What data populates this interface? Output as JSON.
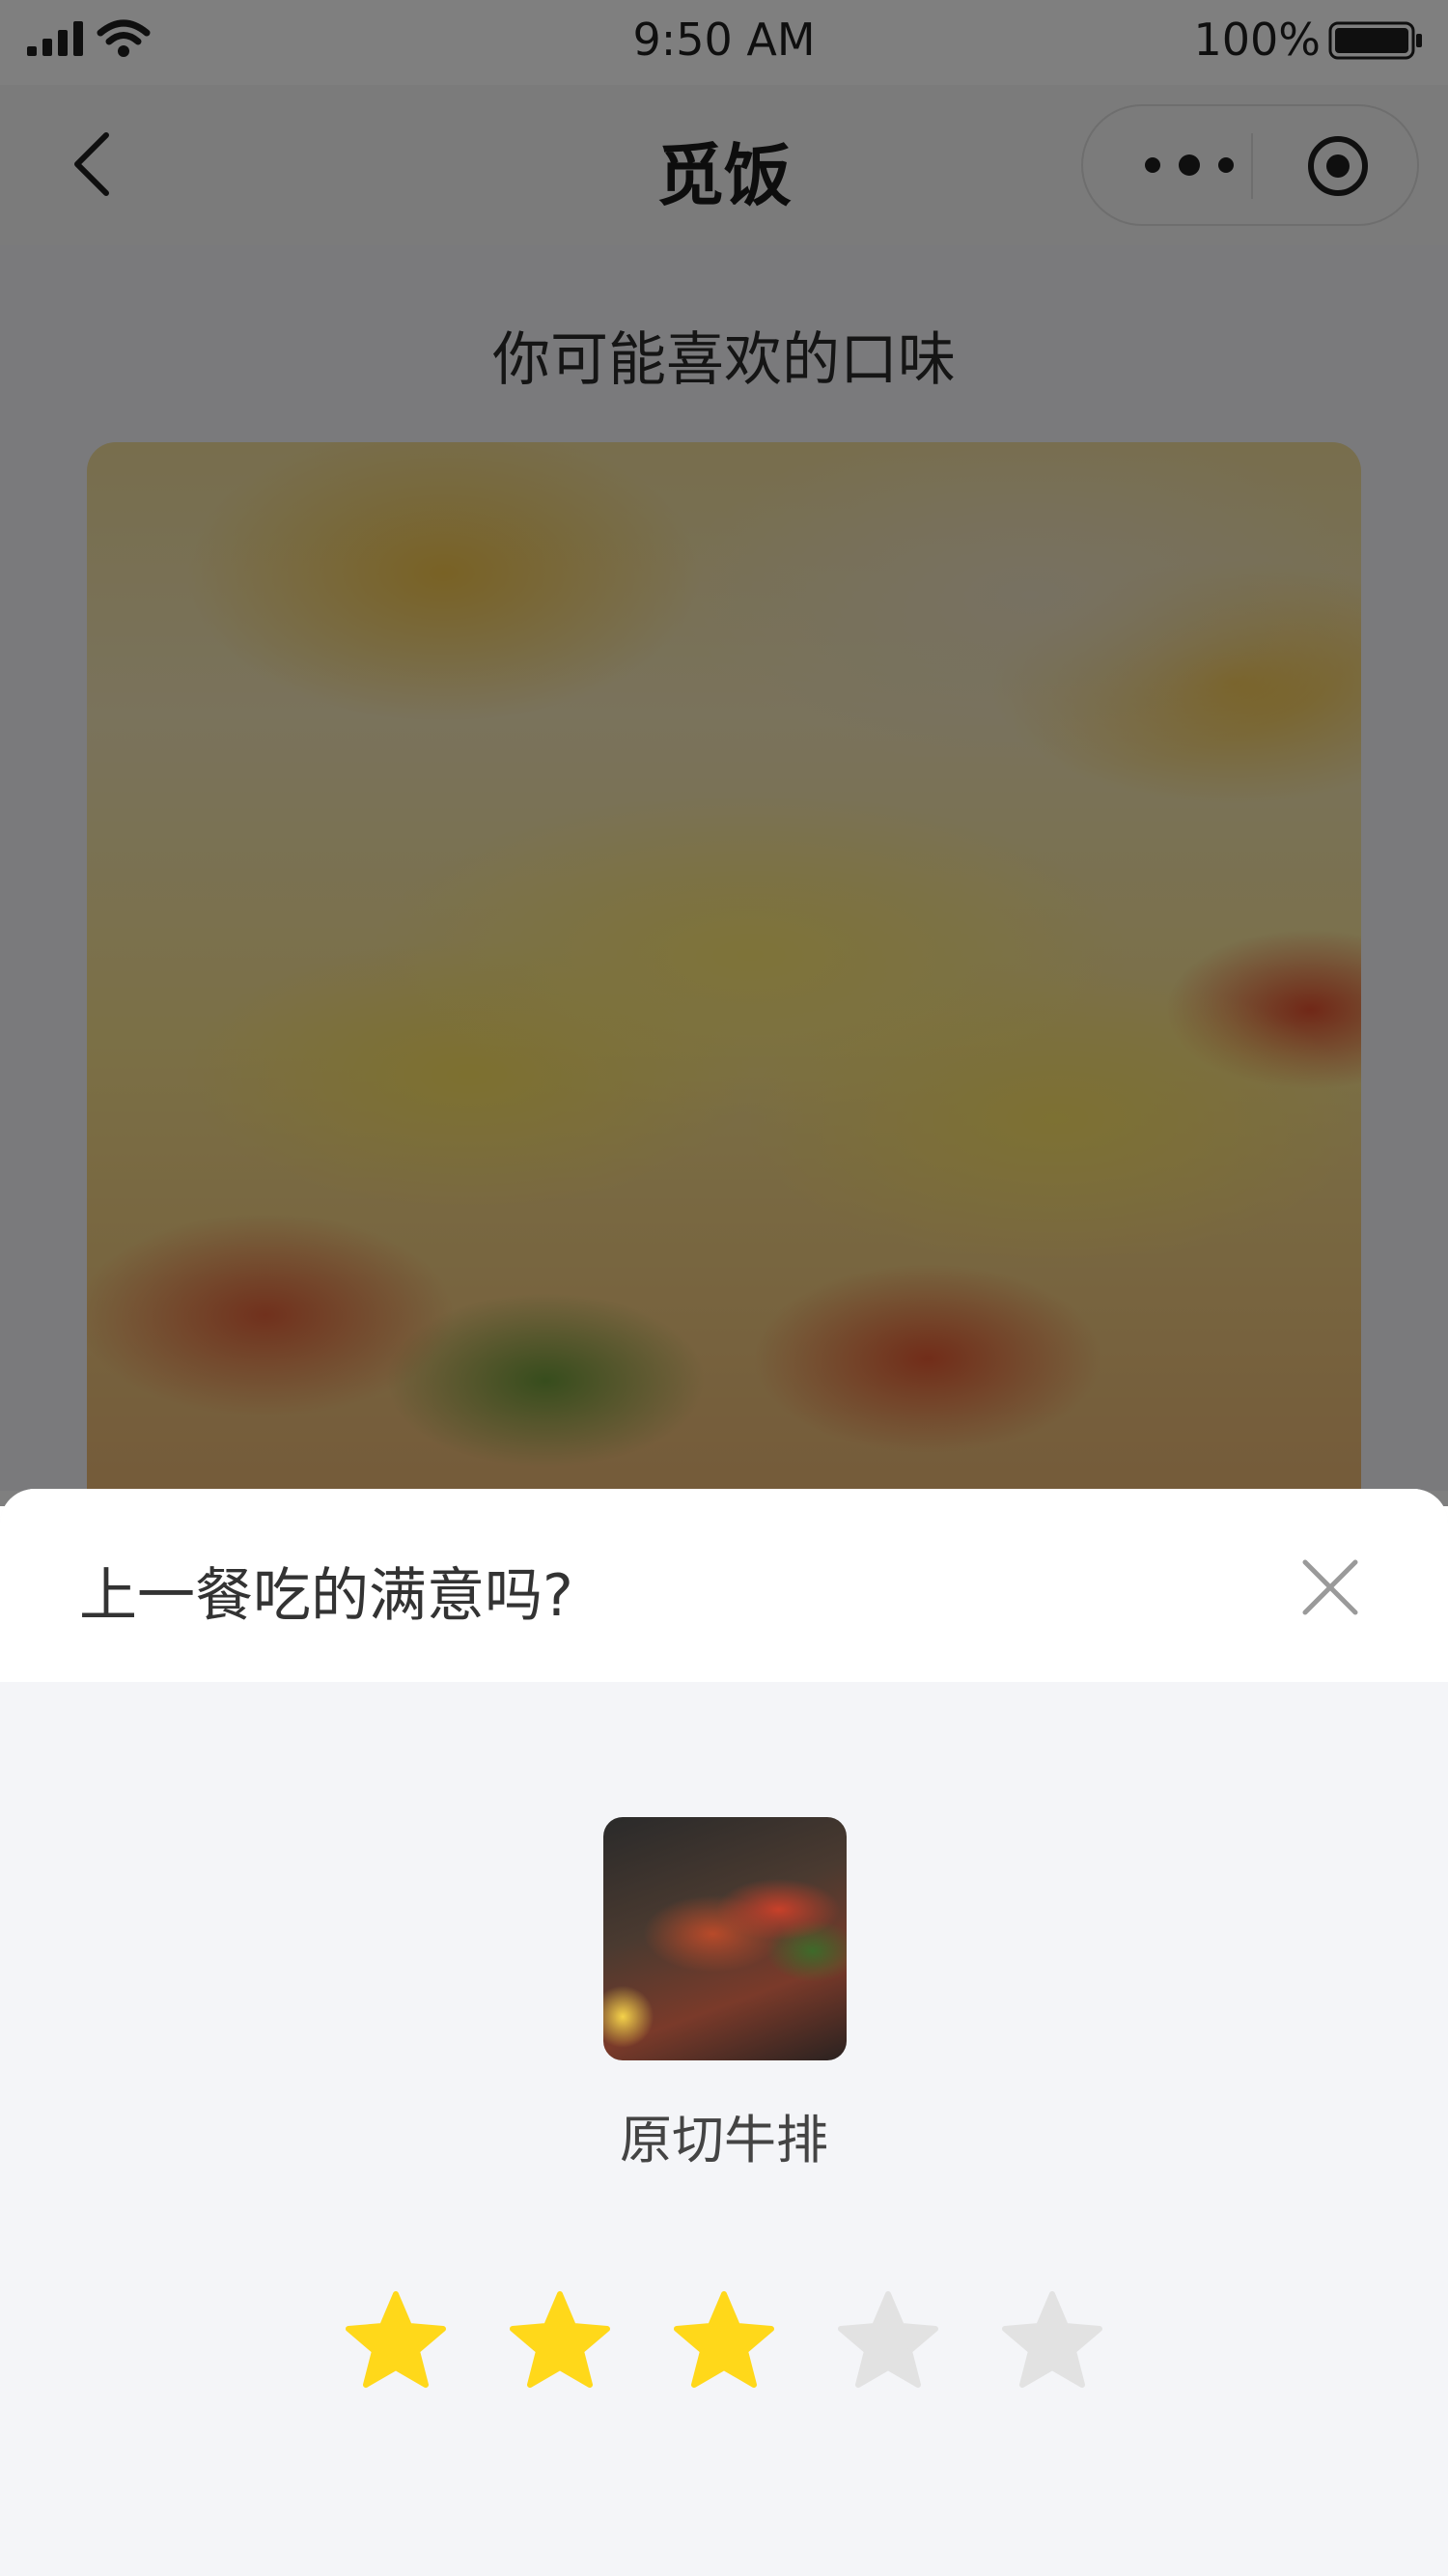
{
  "status_bar": {
    "time": "9:50 AM",
    "battery": "100%"
  },
  "nav": {
    "title": "觅饭"
  },
  "page": {
    "section_title": "你可能喜欢的口味"
  },
  "sheet": {
    "title": "上一餐吃的满意吗?",
    "dish_name": "原切牛排",
    "rating": {
      "value": 3,
      "max": 5
    }
  },
  "colors": {
    "star_filled": "#ffd81a",
    "star_empty": "#e2e2e2",
    "overlay": "rgba(0,0,0,0.5)",
    "sheet_background": "#f4f5f8"
  },
  "icons": {
    "back": "chevron-left-icon",
    "more": "more-dots-icon",
    "close_capsule": "target-circle-icon",
    "sheet_close": "close-icon",
    "star": "star-icon"
  }
}
